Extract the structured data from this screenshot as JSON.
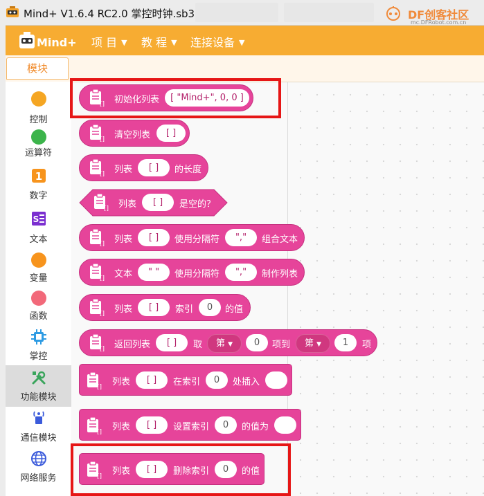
{
  "window": {
    "title": "Mind+ V1.6.4 RC2.0   掌控时钟.sb3",
    "watermark_brand": "DF创客社区",
    "watermark_url": "mc.DFRobot.com.cn"
  },
  "menu": {
    "logo_text": "Mind+",
    "items": [
      {
        "label": "项 目"
      },
      {
        "label": "教 程"
      },
      {
        "label": "连接设备"
      }
    ]
  },
  "tabs": {
    "blocks": "模块"
  },
  "categories": [
    {
      "label": "控制",
      "icon": "control-dot-icon",
      "color": "#f5a623"
    },
    {
      "label": "运算符",
      "icon": "operators-dot-icon",
      "color": "#3cb44b"
    },
    {
      "label": "数字",
      "icon": "number-one-icon",
      "color": "#f7941d"
    },
    {
      "label": "文本",
      "icon": "text-icon",
      "color": "#7b2fd0"
    },
    {
      "label": "变量",
      "icon": "variables-dot-icon",
      "color": "#f7941d"
    },
    {
      "label": "函数",
      "icon": "functions-dot-icon",
      "color": "#f2697a"
    },
    {
      "label": "掌控",
      "icon": "chip-icon",
      "color": "#2d9be3"
    },
    {
      "label": "功能模块",
      "icon": "tools-icon",
      "color": "#3aa55c"
    },
    {
      "label": "通信模块",
      "icon": "antenna-icon",
      "color": "#3b5bdb"
    },
    {
      "label": "网络服务",
      "icon": "globe-icon",
      "color": "#3b5bdb"
    }
  ],
  "blocks": {
    "init_list": {
      "label": "初始化列表",
      "value": "[ \"Mind+\", 0, 0 ]"
    },
    "clear_list": {
      "label": "清空列表",
      "value": "[  ]"
    },
    "list_length": {
      "prefix": "列表",
      "value": "[  ]",
      "suffix": "的长度"
    },
    "list_empty": {
      "prefix": "列表",
      "value": "[  ]",
      "suffix": "是空的？"
    },
    "join_text": {
      "prefix": "列表",
      "value": "[  ]",
      "mid": "使用分隔符",
      "sep": "\",\"",
      "suffix": "组合文本"
    },
    "split_text": {
      "prefix": "文本",
      "value": "\"  \"",
      "mid": "使用分隔符",
      "sep": "\",\"",
      "suffix": "制作列表"
    },
    "get_index": {
      "prefix": "列表",
      "value": "[  ]",
      "mid": "索引",
      "index": "0",
      "suffix": "的值"
    },
    "sublist": {
      "prefix": "返回列表",
      "value": "[  ]",
      "mid1": "取",
      "drop1": "第",
      "from": "0",
      "mid2": "项到",
      "drop2": "第",
      "to": "1",
      "suffix": "项"
    },
    "insert": {
      "prefix": "列表",
      "value": "[  ]",
      "mid": "在索引",
      "index": "0",
      "suffix": "处插入"
    },
    "set_index": {
      "prefix": "列表",
      "value": "[  ]",
      "mid": "设置索引",
      "index": "0",
      "suffix": "的值为"
    },
    "delete_index": {
      "prefix": "列表",
      "value": "[  ]",
      "mid": "删除索引",
      "index": "0",
      "suffix": "的值"
    }
  },
  "colors": {
    "block": "#e6449a",
    "menubar": "#f7ac32",
    "highlight": "#e61616"
  }
}
